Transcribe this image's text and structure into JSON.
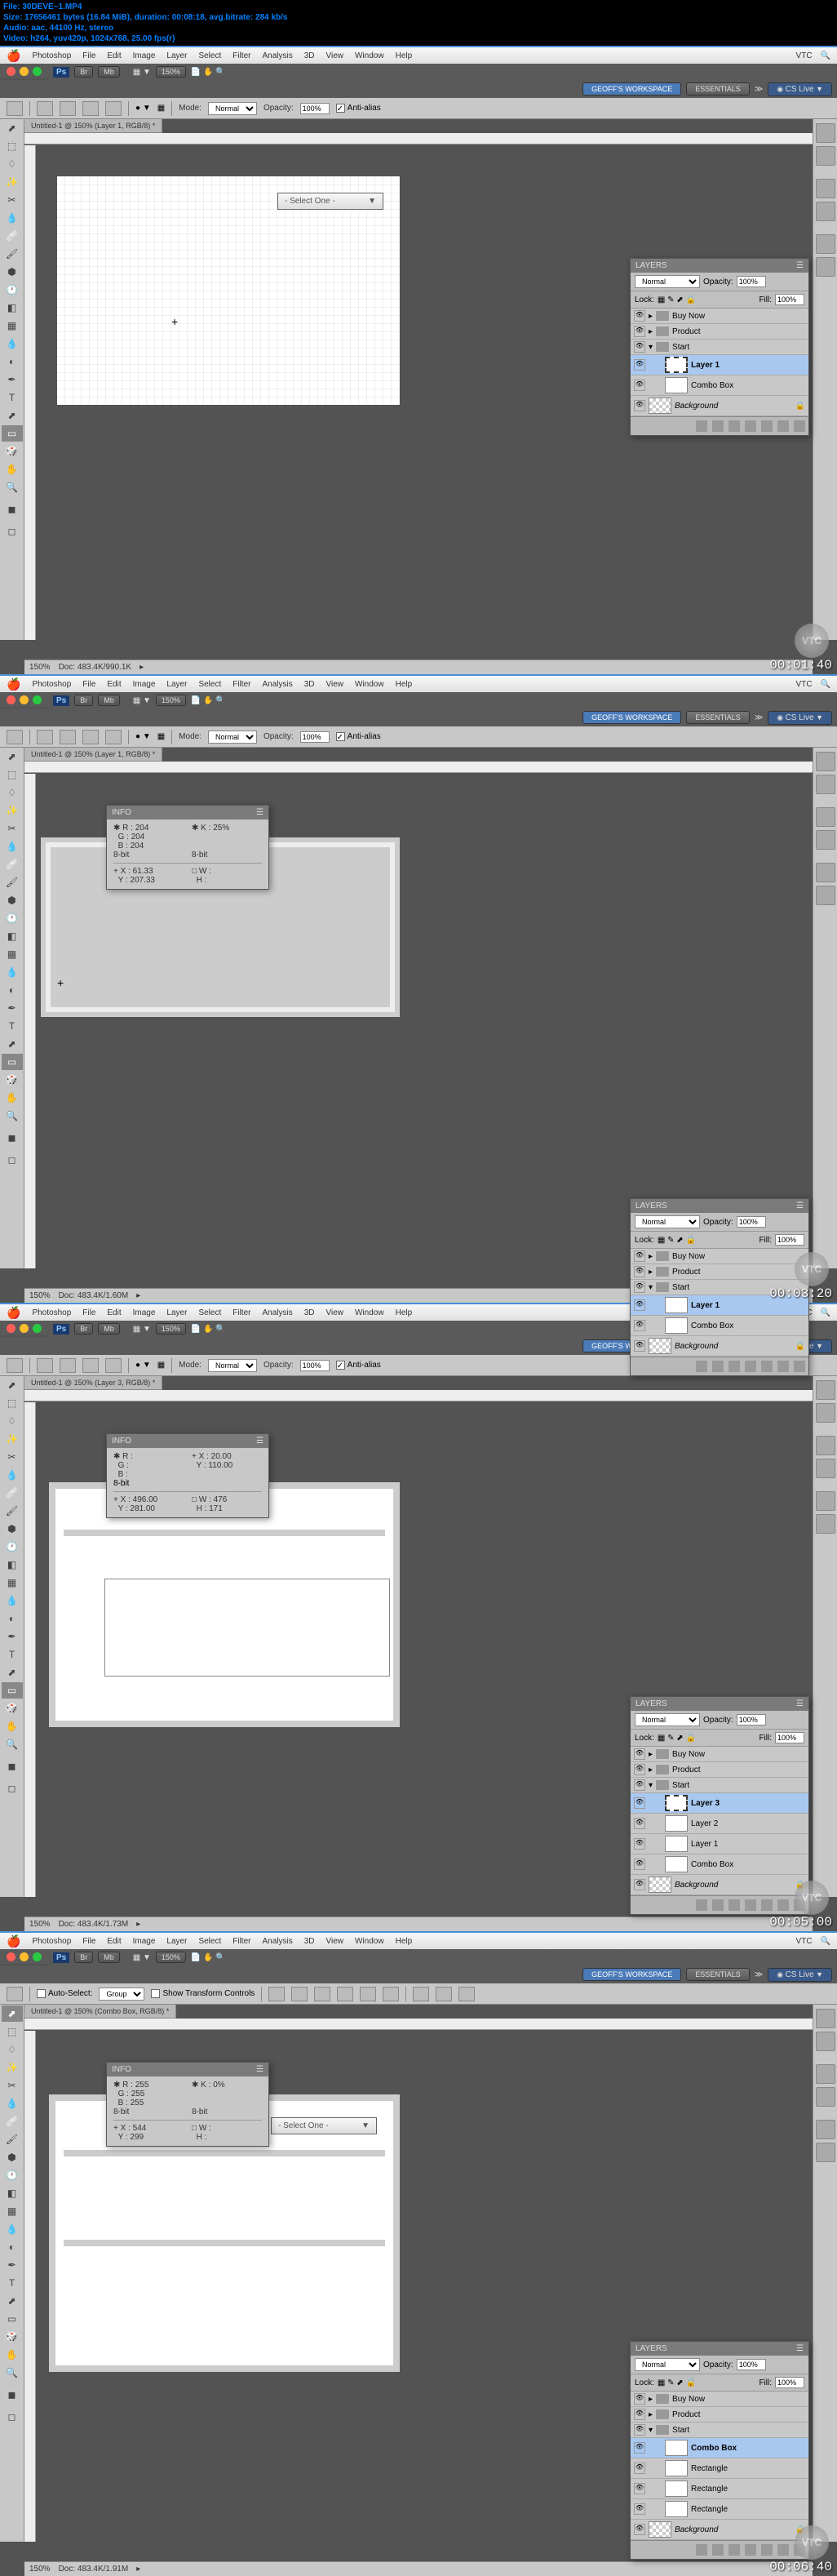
{
  "file_info": {
    "line1": "File: 30DEVE~1.MP4",
    "line2": "Size: 17656461 bytes (16.84 MiB), duration: 00:08:18, avg.bitrate: 284 kb/s",
    "line3": "Audio: aac, 44100 Hz, stereo",
    "line4": "Video: h264, yuv420p, 1024x768, 25.00 fps(r)"
  },
  "menu": {
    "items": [
      "Photoshop",
      "File",
      "Edit",
      "Image",
      "Layer",
      "Select",
      "Filter",
      "Analysis",
      "3D",
      "View",
      "Window",
      "Help"
    ],
    "vtc": "VTC"
  },
  "ps_bar": {
    "ps": "Ps",
    "br": "Br",
    "mb": "Mb",
    "zoom": "150%"
  },
  "workspace": {
    "geoff": "GEOFF'S WORKSPACE",
    "essentials": "ESSENTIALS",
    "cslive": "CS Live"
  },
  "frame1": {
    "doc_tab": "Untitled-1 @ 150% (Layer 1, RGB/8) *",
    "options": {
      "mode": "Mode:",
      "mode_val": "Normal",
      "opacity": "Opacity:",
      "opacity_val": "100%",
      "aa": "Anti-alias"
    },
    "combo": "- Select One -",
    "status": {
      "zoom": "150%",
      "doc": "Doc: 483.4K/990.1K"
    },
    "timestamp": "00:01:40",
    "layers": {
      "title": "LAYERS",
      "mode": "Normal",
      "opacity": "Opacity:",
      "opacity_val": "100%",
      "lock": "Lock:",
      "fill": "Fill:",
      "fill_val": "100%",
      "rows": [
        {
          "name": "Buy Now",
          "type": "folder"
        },
        {
          "name": "Product",
          "type": "folder"
        },
        {
          "name": "Start",
          "type": "folder",
          "open": true
        },
        {
          "name": "Layer 1",
          "type": "layer",
          "sel": true,
          "indent": 1
        },
        {
          "name": "Combo Box",
          "type": "layer",
          "indent": 1
        },
        {
          "name": "Background",
          "type": "bg",
          "italic": true
        }
      ]
    }
  },
  "frame2": {
    "doc_tab": "Untitled-1 @ 150% (Layer 1, RGB/8) *",
    "options": {
      "mode": "Mode:",
      "mode_val": "Normal",
      "opacity": "Opacity:",
      "opacity_val": "100%",
      "aa": "Anti-alias"
    },
    "info": {
      "title": "INFO",
      "r": "R :",
      "r_v": "204",
      "g": "G :",
      "g_v": "204",
      "b": "B :",
      "b_v": "204",
      "k": "K :",
      "k_v": "25%",
      "bit": "8-bit",
      "bit2": "8-bit",
      "x": "X :",
      "x_v": "61.33",
      "y": "Y :",
      "y_v": "207.33",
      "w": "W :",
      "h": "H :"
    },
    "status": {
      "zoom": "150%",
      "doc": "Doc: 483.4K/1.60M"
    },
    "timestamp": "00:03:20",
    "layers": {
      "title": "LAYERS",
      "mode": "Normal",
      "opacity": "Opacity:",
      "opacity_val": "100%",
      "lock": "Lock:",
      "fill": "Fill:",
      "fill_val": "100%",
      "rows": [
        {
          "name": "Buy Now",
          "type": "folder"
        },
        {
          "name": "Product",
          "type": "folder"
        },
        {
          "name": "Start",
          "type": "folder",
          "open": true
        },
        {
          "name": "Layer 1",
          "type": "layer",
          "sel": true,
          "indent": 1
        },
        {
          "name": "Combo Box",
          "type": "layer",
          "indent": 1
        },
        {
          "name": "Background",
          "type": "bg",
          "italic": true
        }
      ]
    }
  },
  "frame3": {
    "doc_tab": "Untitled-1 @ 150% (Layer 3, RGB/8) *",
    "options": {
      "mode": "Mode:",
      "mode_val": "Normal",
      "opacity": "Opacity:",
      "opacity_val": "100%",
      "aa": "Anti-alias"
    },
    "info": {
      "title": "INFO",
      "r": "R :",
      "g": "G :",
      "b": "B :",
      "x2": "X :",
      "x2_v": "20.00",
      "y2": "Y :",
      "y2_v": "110.00",
      "bit": "8-bit",
      "x": "X :",
      "x_v": "496.00",
      "y": "Y :",
      "y_v": "281.00",
      "w": "W :",
      "w_v": "476",
      "h": "H :",
      "h_v": "171"
    },
    "status": {
      "zoom": "150%",
      "doc": "Doc: 483.4K/1.73M"
    },
    "timestamp": "00:05:00",
    "layers": {
      "title": "LAYERS",
      "mode": "Normal",
      "opacity": "Opacity:",
      "opacity_val": "100%",
      "lock": "Lock:",
      "fill": "Fill:",
      "fill_val": "100%",
      "rows": [
        {
          "name": "Buy Now",
          "type": "folder"
        },
        {
          "name": "Product",
          "type": "folder"
        },
        {
          "name": "Start",
          "type": "folder",
          "open": true
        },
        {
          "name": "Layer 3",
          "type": "layer",
          "sel": true,
          "indent": 1
        },
        {
          "name": "Layer 2",
          "type": "layer",
          "indent": 1
        },
        {
          "name": "Layer 1",
          "type": "layer",
          "indent": 1
        },
        {
          "name": "Combo Box",
          "type": "layer",
          "indent": 1
        },
        {
          "name": "Background",
          "type": "bg",
          "italic": true
        }
      ]
    }
  },
  "frame4": {
    "doc_tab": "Untitled-1 @ 150% (Combo Box, RGB/8) *",
    "options": {
      "auto": "Auto-Select:",
      "group": "Group",
      "show": "Show Transform Controls"
    },
    "info": {
      "title": "INFO",
      "r": "R :",
      "r_v": "255",
      "g": "G :",
      "g_v": "255",
      "b": "B :",
      "b_v": "255",
      "k": "K :",
      "k_v": "0%",
      "bit": "8-bit",
      "bit2": "8-bit",
      "x": "X :",
      "x_v": "544",
      "y": "Y :",
      "y_v": "299",
      "w": "W :",
      "h": "H :"
    },
    "combo": "- Select One -",
    "status": {
      "zoom": "150%",
      "doc": "Doc: 483.4K/1.91M"
    },
    "timestamp": "00:06:40",
    "layers": {
      "title": "LAYERS",
      "mode": "Normal",
      "opacity": "Opacity:",
      "opacity_val": "100%",
      "lock": "Lock:",
      "fill": "Fill:",
      "fill_val": "100%",
      "rows": [
        {
          "name": "Buy Now",
          "type": "folder"
        },
        {
          "name": "Product",
          "type": "folder"
        },
        {
          "name": "Start",
          "type": "folder",
          "open": true
        },
        {
          "name": "Combo Box",
          "type": "layer",
          "sel": true,
          "indent": 1
        },
        {
          "name": "Rectangle",
          "type": "layer",
          "indent": 1
        },
        {
          "name": "Rectangle",
          "type": "layer",
          "indent": 1
        },
        {
          "name": "Rectangle",
          "type": "layer",
          "indent": 1
        },
        {
          "name": "Background",
          "type": "bg",
          "italic": true
        }
      ]
    }
  }
}
